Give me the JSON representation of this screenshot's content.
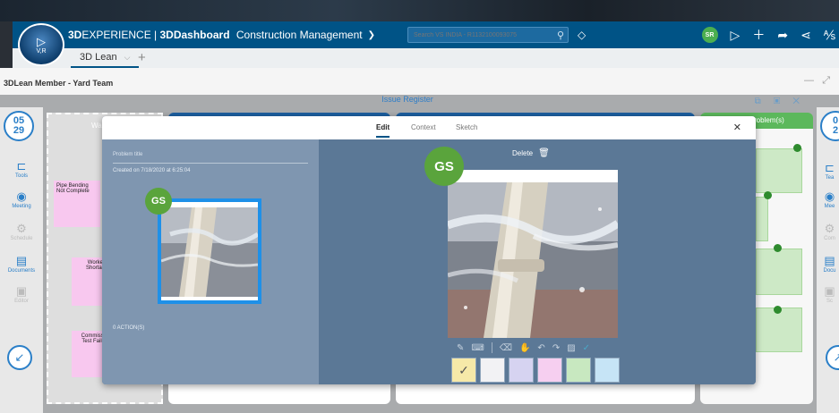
{
  "app": {
    "compass_user": "V,R",
    "brand_prefix": "3D",
    "brand_suffix": "EXPERIENCE",
    "brand_separator": " | ",
    "brand_dashboard": "3DDashboard",
    "app_name": "Construction Management",
    "search_placeholder": "Search VS INDIA - R1132100093075",
    "user_initials": "SR"
  },
  "tabs": [
    {
      "label": "3D Lean"
    }
  ],
  "dashboard": {
    "title": "3DLean Member - Yard Team",
    "header": "Issue Register"
  },
  "rail": {
    "date_left": {
      "day": "05",
      "month": "29"
    },
    "date_right": {
      "day": "0",
      "month": "2"
    },
    "items": [
      {
        "label": "Tools",
        "icon": "tools-icon"
      },
      {
        "label": "Meeting",
        "icon": "meeting-icon"
      },
      {
        "label": "Schedule",
        "icon": "schedule-icon"
      },
      {
        "label": "Documents",
        "icon": "documents-icon"
      },
      {
        "label": "Editor",
        "icon": "editor-icon"
      }
    ],
    "items_right": [
      {
        "label": "Tea"
      },
      {
        "label": "Mee"
      },
      {
        "label": "Com"
      },
      {
        "label": "Docu"
      },
      {
        "label": "Sc"
      }
    ]
  },
  "board": {
    "col1_label": "Wa",
    "col4_label": "roblem(s)",
    "stickies": [
      {
        "text": "Pipe Bending Not Complete"
      },
      {
        "text": "Worker Shortag"
      },
      {
        "text": "Commissi Test Faile"
      }
    ]
  },
  "modal": {
    "tabs": [
      "Edit",
      "Context",
      "Sketch"
    ],
    "active_tab": "Edit",
    "problem_title_label": "Problem title",
    "created": "Created on 7/18/2020 at 6:25:04",
    "actions": "0 ACTION(S)",
    "delete_label": "Delete",
    "avatar_initials": "GS",
    "swatches": [
      "#f6e9a8",
      "#f2f2f4",
      "#d6d3f1",
      "#f6cff0",
      "#c8e8c0",
      "#c6e4f6"
    ],
    "selected_swatch": 0
  },
  "colors": {
    "brand_blue": "#005386",
    "avatar_green": "#5aa43c",
    "sticky_pink": "#f8c8ef",
    "sticky_green": "#cde9c6"
  }
}
